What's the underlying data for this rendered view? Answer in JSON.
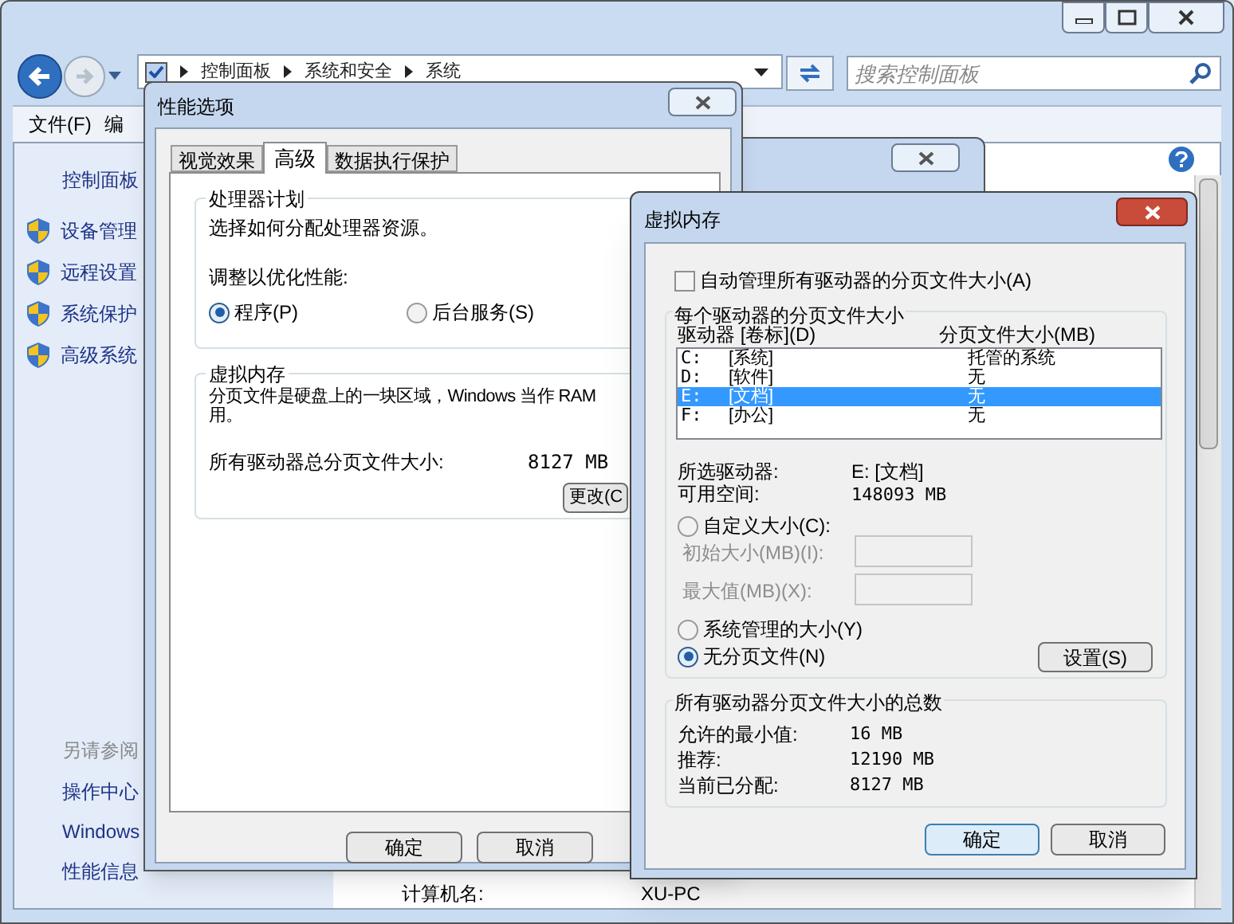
{
  "explorer": {
    "address": [
      "控制面板",
      "系统和安全",
      "系统"
    ],
    "search_placeholder": "搜索控制面板",
    "menu": [
      "文件(F)",
      "编"
    ],
    "sidebar": {
      "home": "控制面板",
      "tasks": [
        "设备管理",
        "远程设置",
        "系统保护",
        "高级系统"
      ],
      "see_also_title": "另请参阅",
      "see_also": [
        "操作中心",
        "Windows",
        "性能信息"
      ]
    },
    "content": {
      "label": "计算机名:",
      "value": "XU-PC"
    }
  },
  "performance_options": {
    "title": "性能选项",
    "tabs": [
      {
        "label": "视觉效果",
        "selected": false
      },
      {
        "label": "高级",
        "selected": true
      },
      {
        "label": "数据执行保护",
        "selected": false
      }
    ],
    "processor_group": {
      "title": "处理器计划",
      "description": "选择如何分配处理器资源。",
      "adjust_label": "调整以优化性能:",
      "options": [
        {
          "label": "程序(P)",
          "selected": true
        },
        {
          "label": "后台服务(S)",
          "selected": false
        }
      ]
    },
    "virtual_memory_group": {
      "title": "虚拟内存",
      "description_lines": [
        "分页文件是硬盘上的一块区域，Windows 当作 RAM",
        "用。"
      ],
      "total_label": "所有驱动器总分页文件大小:",
      "total_value": "8127 MB",
      "change_button": "更改(C"
    },
    "buttons": [
      "确定",
      "取消"
    ]
  },
  "virtual_memory": {
    "title": "虚拟内存",
    "auto_manage": {
      "label": "自动管理所有驱动器的分页文件大小(A)",
      "checked": false
    },
    "per_drive": {
      "title": "每个驱动器的分页文件大小",
      "columns": [
        "驱动器 [卷标](D)",
        "分页文件大小(MB)"
      ],
      "drives": [
        {
          "drive": "C:",
          "volume": "[系统]",
          "size": "托管的系统",
          "selected": false
        },
        {
          "drive": "D:",
          "volume": "[软件]",
          "size": "无",
          "selected": false
        },
        {
          "drive": "E:",
          "volume": "[文档]",
          "size": "无",
          "selected": true
        },
        {
          "drive": "F:",
          "volume": "[办公]",
          "size": "无",
          "selected": false
        }
      ],
      "selected_drive_label": "所选驱动器:",
      "selected_drive_value": "E:  [文档]",
      "free_space_label": "可用空间:",
      "free_space_value": "148093 MB",
      "size_options": [
        {
          "kind": "custom",
          "label": "自定义大小(C):",
          "selected": false
        },
        {
          "kind": "system",
          "label": "系统管理的大小(Y)",
          "selected": false
        },
        {
          "kind": "none",
          "label": "无分页文件(N)",
          "selected": true
        }
      ],
      "initial_size": {
        "label": "初始大小(MB)(I):",
        "disabled": true
      },
      "max_size": {
        "label": "最大值(MB)(X):",
        "disabled": true
      },
      "set_button": "设置(S)"
    },
    "totals": {
      "title": "所有驱动器分页文件大小的总数",
      "rows": [
        {
          "label": "允许的最小值:",
          "value": "16 MB"
        },
        {
          "label": "推荐:",
          "value": "12190 MB"
        },
        {
          "label": "当前已分配:",
          "value": "8127 MB"
        }
      ]
    },
    "buttons": [
      {
        "label": "确定",
        "default": true
      },
      {
        "label": "取消",
        "default": false
      }
    ]
  }
}
